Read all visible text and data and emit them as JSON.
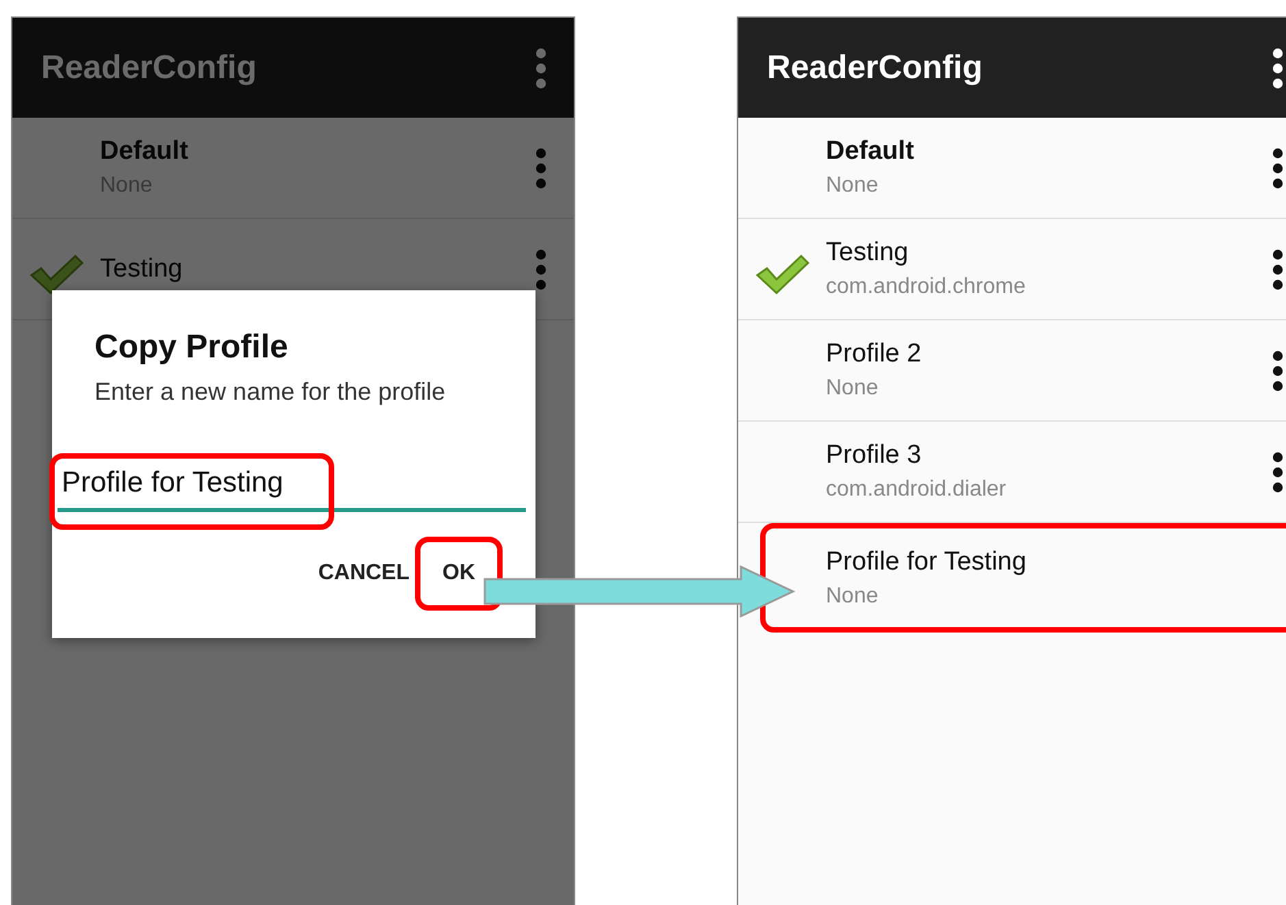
{
  "left_screen": {
    "title": "ReaderConfig",
    "dimmed": true,
    "profiles": [
      {
        "name": "Default",
        "app": "None",
        "kind": "default",
        "selected": false,
        "highlighted": false
      },
      {
        "name": "Testing",
        "kind": "custom",
        "selected": true,
        "highlighted": false
      }
    ],
    "dialog": {
      "title": "Copy Profile",
      "message": "Enter a new name for the profile",
      "field": {
        "value": "Profile for Testing",
        "highlighted": true
      },
      "buttons": [
        {
          "label": "CANCEL",
          "highlighted": false
        },
        {
          "label": "OK",
          "highlighted": true
        }
      ]
    }
  },
  "right_screen": {
    "title": "ReaderConfig",
    "dimmed": false,
    "profiles": [
      {
        "name": "Default",
        "app": "None",
        "kind": "default",
        "selected": false,
        "highlighted": false
      },
      {
        "name": "Testing",
        "app": "com.android.chrome",
        "kind": "custom",
        "selected": true,
        "highlighted": false
      },
      {
        "name": "Profile 2",
        "app": "None",
        "kind": "custom",
        "selected": false,
        "highlighted": false
      },
      {
        "name": "Profile 3",
        "app": "com.android.dialer",
        "kind": "custom",
        "selected": false,
        "highlighted": false
      },
      {
        "name": "Profile for Testing",
        "app": "None",
        "kind": "custom",
        "selected": false,
        "highlighted": true
      }
    ]
  }
}
